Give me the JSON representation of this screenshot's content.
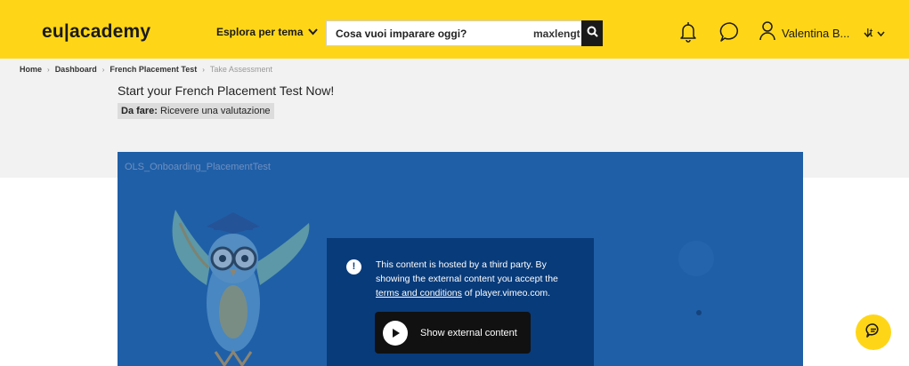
{
  "header": {
    "logo": "eu|academy",
    "explore_label": "Esplora per tema",
    "search": {
      "placeholder": "Cosa vuoi imparare oggi?",
      "extra_text": "maxlengt"
    },
    "user_name": "Valentina B...",
    "language": "It"
  },
  "breadcrumb": {
    "items": [
      "Home",
      "Dashboard",
      "French Placement Test",
      "Take Assessment"
    ]
  },
  "page": {
    "title": "Start your French Placement Test Now!",
    "todo_label": "Da fare:",
    "todo_text": "Ricevere una valutazione"
  },
  "video": {
    "title": "OLS_Onboarding_PlacementTest",
    "consent_text_1": "This content is hosted by a third party. By showing the external content you accept the ",
    "consent_link": "terms and conditions",
    "consent_text_2": " of player.vimeo.com.",
    "show_button": "Show external content"
  },
  "colors": {
    "brand_yellow": "#ffd617",
    "video_blue": "#1f5fa7",
    "consent_blue": "#083b7a"
  },
  "icons": [
    "chevron-down-icon",
    "search-icon",
    "bell-icon",
    "chat-icon",
    "user-icon",
    "info-icon",
    "play-icon",
    "chat-bubble-icon"
  ]
}
